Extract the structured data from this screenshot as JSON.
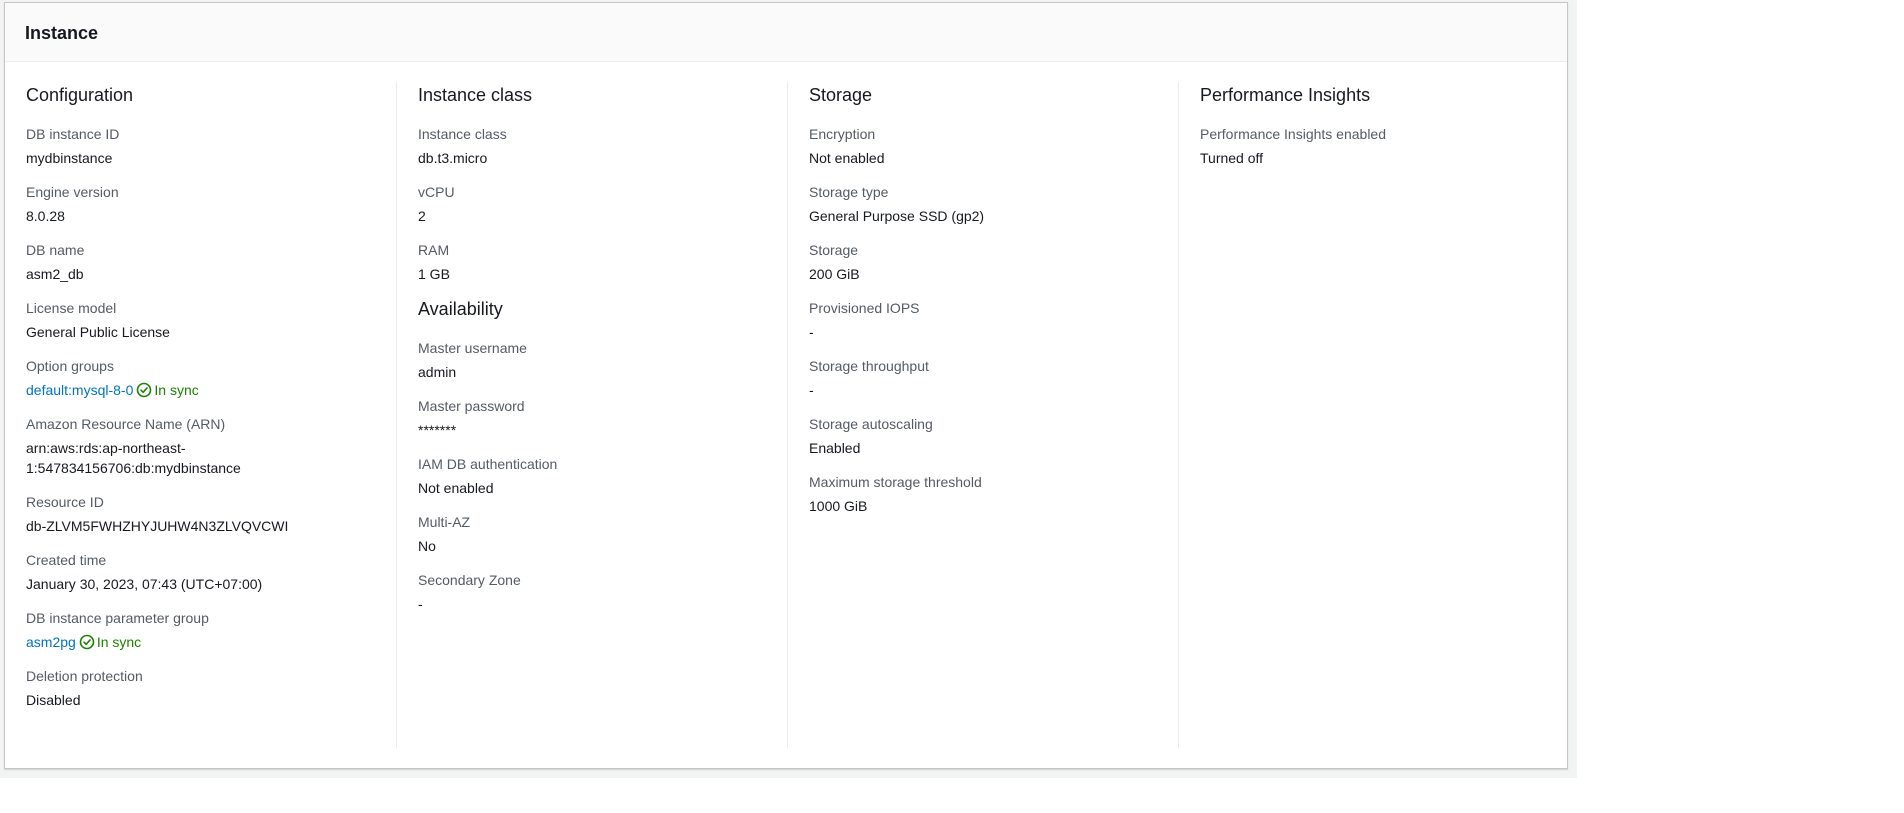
{
  "panel": {
    "title": "Instance"
  },
  "configuration": {
    "title": "Configuration",
    "fields": {
      "db_instance_id": {
        "label": "DB instance ID",
        "value": "mydbinstance"
      },
      "engine_version": {
        "label": "Engine version",
        "value": "8.0.28"
      },
      "db_name": {
        "label": "DB name",
        "value": "asm2_db"
      },
      "license_model": {
        "label": "License model",
        "value": "General Public License"
      },
      "option_groups": {
        "label": "Option groups",
        "link": "default:mysql-8-0",
        "status": "In sync"
      },
      "arn": {
        "label": "Amazon Resource Name (ARN)",
        "value": "arn:aws:rds:ap-northeast-1:547834156706:db:mydbinstance"
      },
      "resource_id": {
        "label": "Resource ID",
        "value": "db-ZLVM5FWHZHYJUHW4N3ZLVQVCWI"
      },
      "created_time": {
        "label": "Created time",
        "value": "January 30, 2023, 07:43 (UTC+07:00)"
      },
      "parameter_group": {
        "label": "DB instance parameter group",
        "link": "asm2pg",
        "status": "In sync"
      },
      "deletion_protection": {
        "label": "Deletion protection",
        "value": "Disabled"
      }
    }
  },
  "instance_class": {
    "title": "Instance class",
    "fields": {
      "instance_class": {
        "label": "Instance class",
        "value": "db.t3.micro"
      },
      "vcpu": {
        "label": "vCPU",
        "value": "2"
      },
      "ram": {
        "label": "RAM",
        "value": "1 GB"
      }
    }
  },
  "availability": {
    "title": "Availability",
    "fields": {
      "master_username": {
        "label": "Master username",
        "value": "admin"
      },
      "master_password": {
        "label": "Master password",
        "value": "*******"
      },
      "iam_auth": {
        "label": "IAM DB authentication",
        "value": "Not enabled"
      },
      "multi_az": {
        "label": "Multi-AZ",
        "value": "No"
      },
      "secondary_zone": {
        "label": "Secondary Zone",
        "value": "-"
      }
    }
  },
  "storage": {
    "title": "Storage",
    "fields": {
      "encryption": {
        "label": "Encryption",
        "value": "Not enabled"
      },
      "storage_type": {
        "label": "Storage type",
        "value": "General Purpose SSD (gp2)"
      },
      "storage": {
        "label": "Storage",
        "value": "200 GiB"
      },
      "provisioned_iops": {
        "label": "Provisioned IOPS",
        "value": "-"
      },
      "throughput": {
        "label": "Storage throughput",
        "value": "-"
      },
      "autoscaling": {
        "label": "Storage autoscaling",
        "value": "Enabled"
      },
      "max_threshold": {
        "label": "Maximum storage threshold",
        "value": "1000 GiB"
      }
    }
  },
  "performance_insights": {
    "title": "Performance Insights",
    "fields": {
      "enabled": {
        "label": "Performance Insights enabled",
        "value": "Turned off"
      }
    }
  },
  "colors": {
    "link": "#0073bb",
    "success": "#1d8102",
    "label": "#545b64",
    "text": "#16191f",
    "border": "#eaeded"
  }
}
